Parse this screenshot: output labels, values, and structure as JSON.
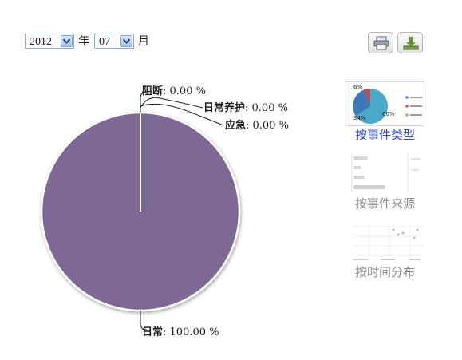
{
  "filters": {
    "year": "2012",
    "year_unit": "年",
    "month": "07",
    "month_unit": "月"
  },
  "toolbar": {
    "print_icon": "printer-icon",
    "download_icon": "download-icon"
  },
  "chart_data": {
    "type": "pie",
    "slices": [
      {
        "label": "阻断",
        "value": 0.0,
        "display": ": 0.00 %"
      },
      {
        "label": "日常养护",
        "value": 0.0,
        "display": ": 0.00 %"
      },
      {
        "label": "应急",
        "value": 0.0,
        "display": ": 0.00 %"
      },
      {
        "label": "日常",
        "value": 100.0,
        "display": ": 100.00 %"
      }
    ],
    "colors": {
      "main": "#7e6896",
      "zero_line": "#ffffff"
    }
  },
  "thumbnails": [
    {
      "label": "按事件类型",
      "active": true,
      "mini": {
        "pct_a": "6%",
        "pct_b": "34%",
        "pct_c": "60%"
      }
    },
    {
      "label": "按事件来源",
      "active": false
    },
    {
      "label": "按时间分布",
      "active": false
    }
  ],
  "colors": {
    "link_active": "#2f48c9",
    "link_inactive": "#8a8a8a"
  }
}
